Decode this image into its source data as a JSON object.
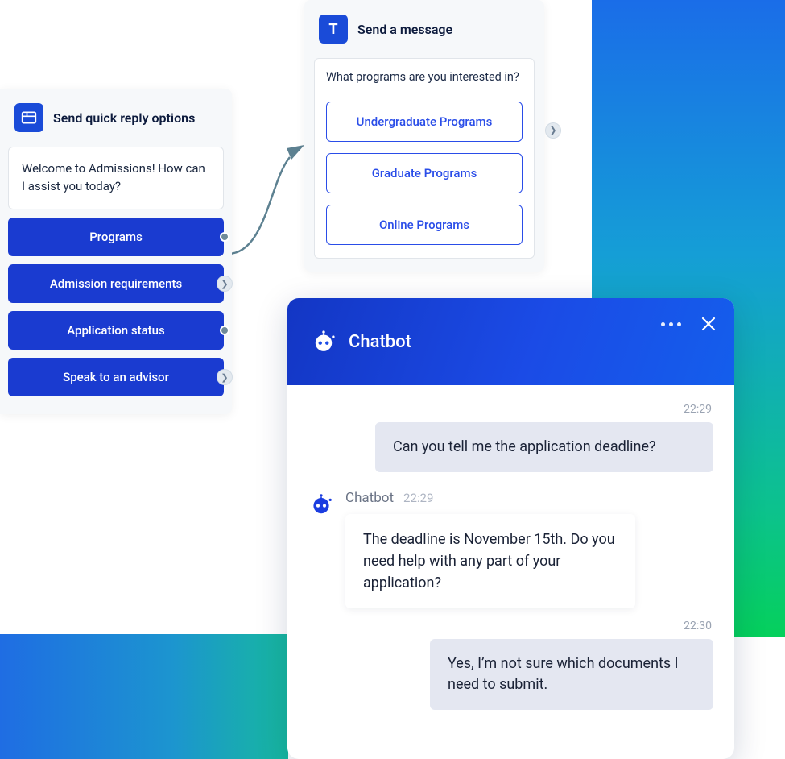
{
  "quick_reply": {
    "title": "Send quick reply options",
    "prompt": "Welcome to Admissions!  How can I assist you today?",
    "options": [
      "Programs",
      "Admission requirements",
      "Application status",
      "Speak to an advisor"
    ]
  },
  "send_message": {
    "title": "Send a message",
    "prompt": "What programs are you interested in?",
    "options": [
      "Undergraduate Programs",
      "Graduate Programs",
      "Online Programs"
    ]
  },
  "chat": {
    "title": "Chatbot",
    "messages": [
      {
        "role": "user",
        "time": "22:29",
        "text": "Can you tell me the application deadline?"
      },
      {
        "role": "bot",
        "name": "Chatbot",
        "time": "22:29",
        "text": "The deadline is November 15th. Do you need help with any part of your application?"
      },
      {
        "role": "user",
        "time": "22:30",
        "text": "Yes, I’m not sure which documents I need to submit."
      }
    ]
  },
  "colors": {
    "brand_blue": "#1a3bd0",
    "outline_blue": "#2a4de8"
  }
}
